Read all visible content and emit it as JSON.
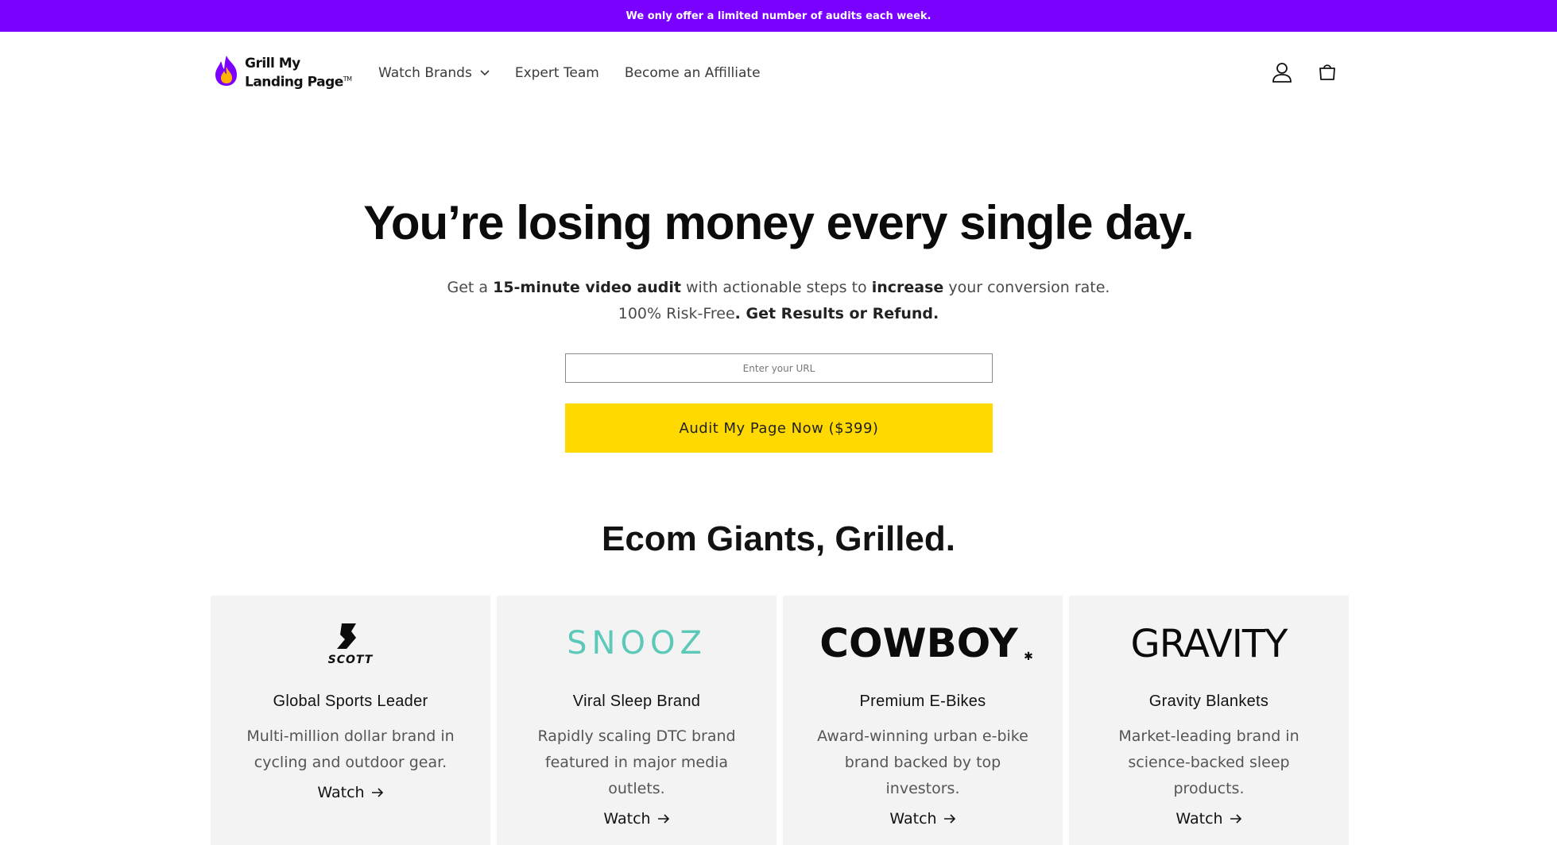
{
  "announcement": {
    "text": "We only offer a limited number of audits each week."
  },
  "header": {
    "logo_line1": "Grill My",
    "logo_line2": "Landing Page",
    "logo_tm": "TM",
    "nav": [
      {
        "label": "Watch Brands",
        "has_dropdown": true
      },
      {
        "label": "Expert Team"
      },
      {
        "label": "Become an Affilliate"
      }
    ],
    "icons": [
      "account-icon",
      "cart-icon"
    ]
  },
  "hero": {
    "title": "You’re losing money every single day.",
    "sub_line1_a": "Get a ",
    "sub_line1_b": "15-minute video audit",
    "sub_line1_c": " with actionable steps to ",
    "sub_line1_d": "increase",
    "sub_line1_e": " your conversion rate.",
    "sub_line2_a": "100% Risk-Free",
    "sub_line2_b": ". Get Results or Refund.",
    "input_placeholder": "Enter your URL",
    "cta_label": "Audit My Page Now ($399)"
  },
  "section": {
    "title_a": "Ecom ",
    "title_b": "Giants",
    "title_c": ", Grilled."
  },
  "cards": [
    {
      "logo_text": "SCOTT",
      "title": "Global Sports Leader",
      "desc": "Multi-million dollar brand in cycling and outdoor gear.",
      "link": "Watch"
    },
    {
      "logo_text": "SNOOZ",
      "title": "Viral Sleep Brand",
      "desc": "Rapidly scaling DTC brand featured in major media outlets.",
      "link": "Watch"
    },
    {
      "logo_text": "COWBOY",
      "title": "Premium E-Bikes",
      "desc": "Award-winning urban e-bike brand backed by top investors.",
      "link": "Watch"
    },
    {
      "logo_text": "GRAVITY",
      "title": "Gravity Blankets",
      "desc": "Market-leading brand in science-backed sleep products.",
      "link": "Watch"
    }
  ],
  "colors": {
    "announcement_bg": "#7a00ff",
    "cta_bg": "#ffd900",
    "card_bg": "#f3f3f3",
    "snooz_teal": "#5cc9b8"
  }
}
